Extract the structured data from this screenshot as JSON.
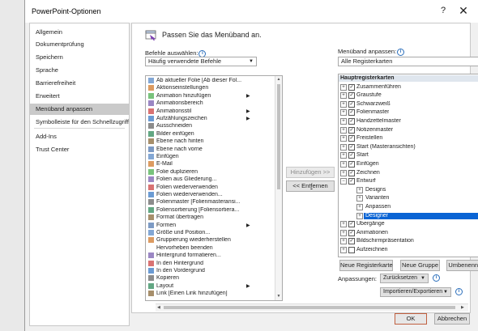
{
  "window": {
    "title": "PowerPoint-Optionen",
    "help": "?",
    "close": "✕"
  },
  "nav": {
    "items": [
      {
        "label": "Allgemein"
      },
      {
        "label": "Dokumentprüfung"
      },
      {
        "label": "Speichern"
      },
      {
        "label": "Sprache"
      },
      {
        "label": "Barrierefreiheit"
      },
      {
        "label": "Erweitert"
      },
      {
        "label": "Menüband anpassen",
        "active": true
      },
      {
        "label": "Symbolleiste für den Schnellzugriff"
      },
      {
        "label": "Add-Ins"
      },
      {
        "label": "Trust Center"
      }
    ]
  },
  "header": {
    "text": "Passen Sie das Menüband an."
  },
  "left": {
    "label": "Befehle auswählen:",
    "info": "i",
    "selected": "Häufig verwendete Befehle",
    "commands": [
      {
        "label": "Ab aktueller Folie [Ab dieser Fol...",
        "icon": "slideshow-icon",
        "sub": false
      },
      {
        "label": "Aktionseinstellungen",
        "icon": "action-icon",
        "sub": false
      },
      {
        "label": "Animation hinzufügen",
        "icon": "star-icon",
        "sub": true
      },
      {
        "label": "Animationsbereich",
        "icon": "animation-pane-icon",
        "sub": false
      },
      {
        "label": "Animationsstil",
        "icon": "star-icon",
        "sub": true
      },
      {
        "label": "Aufzählungszeichen",
        "icon": "bullets-icon",
        "sub": true
      },
      {
        "label": "Ausschneiden",
        "icon": "scissors-icon",
        "sub": false
      },
      {
        "label": "Bilder einfügen",
        "icon": "picture-icon",
        "sub": false
      },
      {
        "label": "Ebene nach hinten",
        "icon": "send-back-icon",
        "sub": false
      },
      {
        "label": "Ebene nach vorne",
        "icon": "bring-forward-icon",
        "sub": false
      },
      {
        "label": "Einfügen",
        "icon": "paste-icon",
        "sub": false
      },
      {
        "label": "E-Mail",
        "icon": "email-icon",
        "sub": false
      },
      {
        "label": "Folie duplizieren",
        "icon": "duplicate-slide-icon",
        "sub": false
      },
      {
        "label": "Folien aus Gliederung...",
        "icon": "outline-icon",
        "sub": false
      },
      {
        "label": "Folien wiederverwenden",
        "icon": "reuse-slides-icon",
        "sub": false
      },
      {
        "label": "Folien wiederverwenden...",
        "icon": "reuse-slides-icon",
        "sub": false
      },
      {
        "label": "Folienmaster [Folienmasteransi...",
        "icon": "slide-master-icon",
        "sub": false
      },
      {
        "label": "Foliensortierung [Foliensortiera...",
        "icon": "slide-sorter-icon",
        "sub": false
      },
      {
        "label": "Format übertragen",
        "icon": "format-painter-icon",
        "sub": false
      },
      {
        "label": "Formen",
        "icon": "shapes-icon",
        "sub": true
      },
      {
        "label": "Größe und Position...",
        "icon": "size-position-icon",
        "sub": false
      },
      {
        "label": "Gruppierung wiederherstellen",
        "icon": "regroup-icon",
        "sub": false
      },
      {
        "label": "Hervorheben beenden",
        "icon": "blank-icon",
        "sub": false
      },
      {
        "label": "Hintergrund formatieren...",
        "icon": "background-icon",
        "sub": false
      },
      {
        "label": "In den Hintergrund",
        "icon": "send-to-back-icon",
        "sub": false
      },
      {
        "label": "In den Vordergrund",
        "icon": "bring-to-front-icon",
        "sub": false
      },
      {
        "label": "Kopieren",
        "icon": "copy-icon",
        "sub": false
      },
      {
        "label": "Layout",
        "icon": "layout-icon",
        "sub": true
      },
      {
        "label": "Link [Einen Link hinzufügen]",
        "icon": "link-icon",
        "sub": false
      }
    ]
  },
  "middle": {
    "add_label": "Hinzufügen >>",
    "remove_label": "<< Entfernen"
  },
  "right": {
    "label": "Menüband anpassen:",
    "info": "i",
    "selected": "Alle Registerkarten",
    "tree": [
      {
        "label": "Hauptregisterkarten",
        "kind": "header"
      },
      {
        "label": "Zusammenführen",
        "kind": "tab",
        "expander": "+",
        "checked": true
      },
      {
        "label": "Graustufe",
        "kind": "tab",
        "expander": "+",
        "checked": true
      },
      {
        "label": "Schwarzweiß",
        "kind": "tab",
        "expander": "+",
        "checked": true
      },
      {
        "label": "Folienmaster",
        "kind": "tab",
        "expander": "+",
        "checked": true
      },
      {
        "label": "Handzettelmaster",
        "kind": "tab",
        "expander": "+",
        "checked": true
      },
      {
        "label": "Notizenmaster",
        "kind": "tab",
        "expander": "+",
        "checked": true
      },
      {
        "label": "Freistellen",
        "kind": "tab",
        "expander": "+",
        "checked": true
      },
      {
        "label": "Start (Masteransichten)",
        "kind": "tab",
        "expander": "+",
        "checked": true
      },
      {
        "label": "Start",
        "kind": "tab",
        "expander": "+",
        "checked": true
      },
      {
        "label": "Einfügen",
        "kind": "tab",
        "expander": "+",
        "checked": true
      },
      {
        "label": "Zeichnen",
        "kind": "tab",
        "expander": "+",
        "checked": true
      },
      {
        "label": "Entwurf",
        "kind": "tab",
        "expander": "−",
        "checked": true
      },
      {
        "label": "Designs",
        "kind": "group",
        "expander": "+"
      },
      {
        "label": "Varianten",
        "kind": "group",
        "expander": "+"
      },
      {
        "label": "Anpassen",
        "kind": "group",
        "expander": "+"
      },
      {
        "label": "Designer",
        "kind": "group",
        "expander": "+",
        "selected": true
      },
      {
        "label": "Übergänge",
        "kind": "tab",
        "expander": "+",
        "checked": true
      },
      {
        "label": "Animationen",
        "kind": "tab",
        "expander": "+",
        "checked": true
      },
      {
        "label": "Bildschirmpräsentation",
        "kind": "tab",
        "expander": "+",
        "checked": true
      },
      {
        "label": "Aufzeichnen",
        "kind": "tab",
        "expander": "+",
        "checked": false
      }
    ],
    "new_tab": "Neue Registerkarte",
    "new_group": "Neue Gruppe",
    "rename": "Umbenennen...",
    "customizations_label": "Anpassungen:",
    "reset": "Zurücksetzen",
    "import_export": "Importieren/Exportieren"
  },
  "footer": {
    "ok": "OK",
    "cancel": "Abbrechen"
  },
  "colors": {
    "selection": "#0a64d4",
    "nav_active": "#cacaca",
    "ok_border": "#c06040"
  }
}
